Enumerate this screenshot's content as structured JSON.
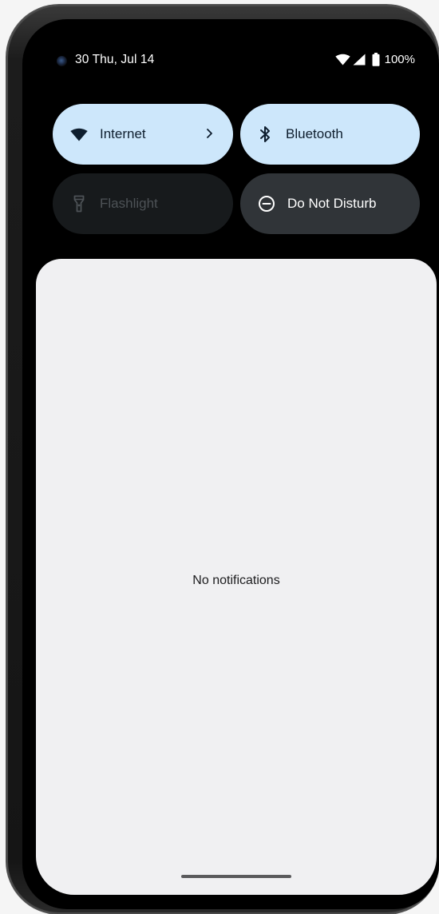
{
  "status_bar": {
    "date": "30 Thu, Jul 14",
    "battery": "100%",
    "icons": [
      "camera-icon",
      "wifi-icon",
      "signal-icon",
      "battery-icon"
    ]
  },
  "quick_settings": {
    "tiles": [
      {
        "label": "Internet",
        "icon": "wifi-icon",
        "state": "on",
        "has_chevron": true
      },
      {
        "label": "Bluetooth",
        "icon": "bluetooth-icon",
        "state": "on"
      },
      {
        "label": "Flashlight",
        "icon": "flashlight-icon",
        "state": "unavailable"
      },
      {
        "label": "Do Not Disturb",
        "icon": "do-not-disturb-icon",
        "state": "off"
      }
    ]
  },
  "notifications": {
    "empty_message": "No notifications"
  },
  "colors": {
    "tile_on": "#cde7fb",
    "tile_off": "#303438",
    "tile_unavailable": "#171a1c",
    "panel_bg": "#f0f0f2",
    "screen_bg": "#000000"
  }
}
